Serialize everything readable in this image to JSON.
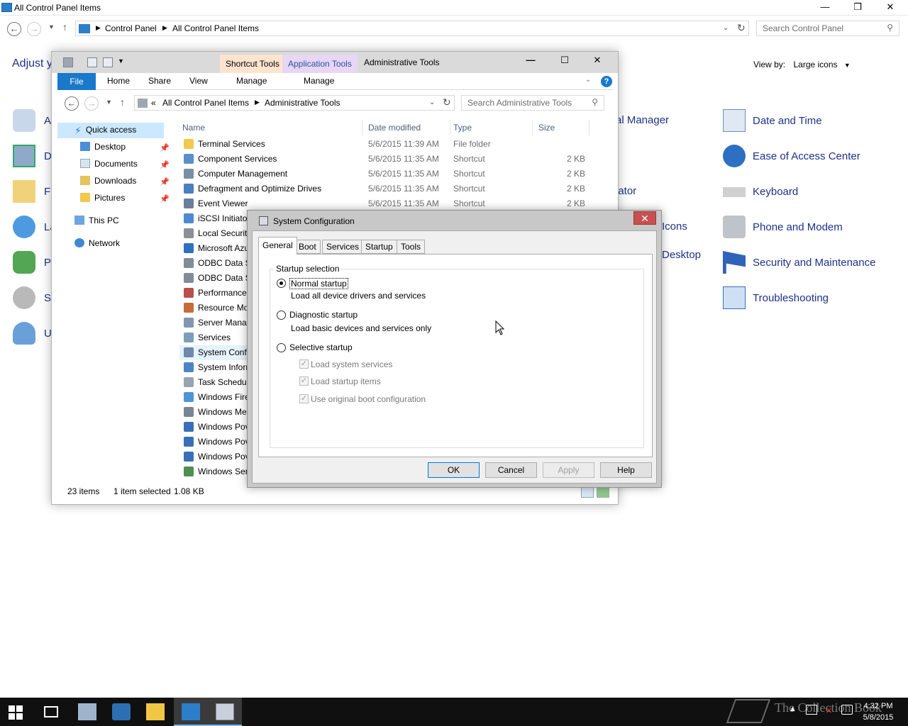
{
  "control_panel": {
    "title": "All Control Panel Items",
    "window_controls": [
      "—",
      "❐",
      "✕"
    ],
    "breadcrumb": [
      "Control Panel",
      "All Control Panel Items"
    ],
    "search_placeholder": "Search Control Panel",
    "adjust_partial": "Adjust y",
    "view_by_label": "View by:",
    "view_by_value": "Large icons",
    "partial_items": [
      "al Manager",
      "iator",
      "Icons",
      "Desktop"
    ],
    "right_items": [
      {
        "label": "Date and Time",
        "icon": "date-time-icon"
      },
      {
        "label": "Ease of Access Center",
        "icon": "ease-of-access-icon"
      },
      {
        "label": "Keyboard",
        "icon": "keyboard-icon"
      },
      {
        "label": "Phone and Modem",
        "icon": "phone-modem-icon"
      },
      {
        "label": "Security and Maintenance",
        "icon": "flag-icon"
      },
      {
        "label": "Troubleshooting",
        "icon": "troubleshooting-icon"
      }
    ],
    "left_partial_letters": [
      "A",
      "D",
      "Fi",
      "La",
      "Pe",
      "S",
      "U"
    ]
  },
  "admin_tools": {
    "title": "Administrative Tools",
    "context_tabs": [
      "Shortcut Tools",
      "Application Tools"
    ],
    "ribbon_tabs": [
      "File",
      "Home",
      "Share",
      "View",
      "Manage",
      "Manage"
    ],
    "window_controls": [
      "—",
      "☐",
      "✕"
    ],
    "breadcrumb": [
      "All Control Panel Items",
      "Administrative Tools"
    ],
    "breadcrumb_prefix": "«",
    "search_placeholder": "Search Administrative Tools",
    "nav": {
      "quick_access": "Quick access",
      "pinned": [
        "Desktop",
        "Documents",
        "Downloads",
        "Pictures"
      ],
      "this_pc": "This PC",
      "network": "Network"
    },
    "columns": [
      "Name",
      "Date modified",
      "Type",
      "Size"
    ],
    "files": [
      {
        "name": "Terminal Services",
        "date": "5/6/2015 11:39 AM",
        "type": "File folder",
        "size": ""
      },
      {
        "name": "Component Services",
        "date": "5/6/2015 11:35 AM",
        "type": "Shortcut",
        "size": "2 KB"
      },
      {
        "name": "Computer Management",
        "date": "5/6/2015 11:35 AM",
        "type": "Shortcut",
        "size": "2 KB"
      },
      {
        "name": "Defragment and Optimize Drives",
        "date": "5/6/2015 11:35 AM",
        "type": "Shortcut",
        "size": "2 KB"
      },
      {
        "name": "Event Viewer",
        "date": "5/6/2015 11:35 AM",
        "type": "Shortcut",
        "size": "2 KB"
      },
      {
        "name": "iSCSI Initiator",
        "date": "",
        "type": "",
        "size": ""
      },
      {
        "name": "Local Security",
        "date": "",
        "type": "",
        "size": ""
      },
      {
        "name": "Microsoft Azu",
        "date": "",
        "type": "",
        "size": ""
      },
      {
        "name": "ODBC Data So",
        "date": "",
        "type": "",
        "size": ""
      },
      {
        "name": "ODBC Data So",
        "date": "",
        "type": "",
        "size": ""
      },
      {
        "name": "Performance",
        "date": "",
        "type": "",
        "size": ""
      },
      {
        "name": "Resource Mo",
        "date": "",
        "type": "",
        "size": ""
      },
      {
        "name": "Server Manag",
        "date": "",
        "type": "",
        "size": ""
      },
      {
        "name": "Services",
        "date": "",
        "type": "",
        "size": ""
      },
      {
        "name": "System Confi",
        "date": "",
        "type": "",
        "size": ""
      },
      {
        "name": "System Inform",
        "date": "",
        "type": "",
        "size": ""
      },
      {
        "name": "Task Schedule",
        "date": "",
        "type": "",
        "size": ""
      },
      {
        "name": "Windows Fire",
        "date": "",
        "type": "",
        "size": ""
      },
      {
        "name": "Windows Me",
        "date": "",
        "type": "",
        "size": ""
      },
      {
        "name": "Windows Pov",
        "date": "",
        "type": "",
        "size": ""
      },
      {
        "name": "Windows Pov",
        "date": "",
        "type": "",
        "size": ""
      },
      {
        "name": "Windows Pov",
        "date": "",
        "type": "",
        "size": ""
      },
      {
        "name": "Windows Ser",
        "date": "",
        "type": "",
        "size": ""
      }
    ],
    "status": {
      "count": "23 items",
      "selected": "1 item selected",
      "size": "1.08 KB"
    }
  },
  "msconfig": {
    "title": "System Configuration",
    "close": "✕",
    "tabs": [
      "General",
      "Boot",
      "Services",
      "Startup",
      "Tools"
    ],
    "group_label": "Startup selection",
    "options": [
      {
        "label": "Normal startup",
        "desc": "Load all device drivers and services",
        "selected": true
      },
      {
        "label": "Diagnostic startup",
        "desc": "Load basic devices and services only",
        "selected": false
      },
      {
        "label": "Selective startup",
        "desc": "",
        "selected": false
      }
    ],
    "checks": [
      "Load system services",
      "Load startup items",
      "Use original boot configuration"
    ],
    "buttons": [
      "OK",
      "Cancel",
      "Apply",
      "Help"
    ]
  },
  "taskbar": {
    "watermark": "The Collection Book",
    "time": "4:32 PM",
    "date": "5/8/2015"
  },
  "colors": {
    "link_blue": "#1e3287",
    "accent": "#1979ca",
    "shortcut_tab": "#fde4cf",
    "application_tab": "#e8d6f5",
    "close_red": "#c75050"
  }
}
